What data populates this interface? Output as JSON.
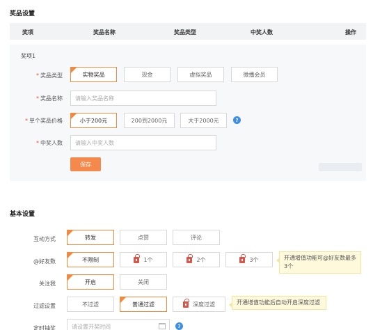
{
  "prize_section": {
    "title": "奖品设置",
    "table_headers": [
      "奖项",
      "奖品名称",
      "奖品类型",
      "中奖人数",
      "操作"
    ],
    "item_title": "奖项1",
    "prize_type_label": "奖品类型",
    "prize_types": [
      "实物奖品",
      "现金",
      "虚拟奖品",
      "微播会员"
    ],
    "prize_name_label": "奖品名称",
    "prize_name_placeholder": "请输入奖品名称",
    "price_label": "单个奖品价格",
    "price_options": [
      "小于200元",
      "200到2000元",
      "大于2000元"
    ],
    "winners_label": "中奖人数",
    "winners_placeholder": "请输入中奖人数",
    "save_label": "保存"
  },
  "basic_section": {
    "title": "基本设置",
    "interaction_label": "互动方式",
    "interaction_options": [
      "转发",
      "点赞",
      "评论"
    ],
    "at_friends_label": "@好友数",
    "at_friends_options": [
      "不限制",
      "1个",
      "2个",
      "3个"
    ],
    "at_friends_tip": "开通增值功能可@好友数最多3个",
    "follow_label": "关注我",
    "follow_options": [
      "开启",
      "关闭"
    ],
    "filter_label": "过滤设置",
    "filter_options": [
      "不过滤",
      "普通过滤",
      "深度过滤"
    ],
    "filter_tip": "开通增值功能后自动开启深度过滤",
    "timer_label": "定时抽奖",
    "timer_placeholder": "请设置开奖时间"
  },
  "colors": {
    "accent": "#f08a3e",
    "help": "#3d8ee8",
    "lock": "#d7554b"
  }
}
